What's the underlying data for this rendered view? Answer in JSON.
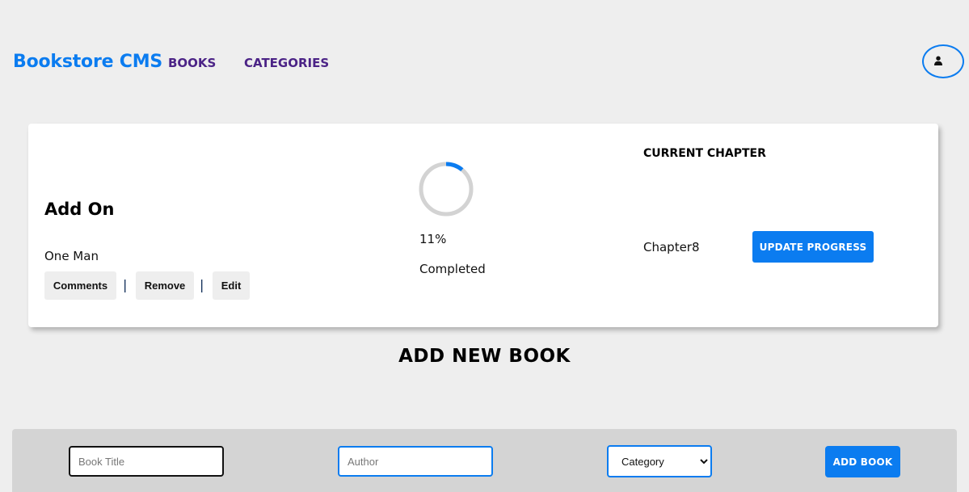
{
  "header": {
    "brand": "Bookstore CMS",
    "nav": {
      "books": "BOOKS",
      "categories": "CATEGORIES"
    },
    "user_icon": "user-icon"
  },
  "book": {
    "title": "Add On",
    "author": "One Man",
    "actions": {
      "comments": "Comments",
      "remove": "Remove",
      "edit": "Edit"
    },
    "separator": "|",
    "progress": {
      "percent_value": 11,
      "percent_label": "11%",
      "status": "Completed"
    },
    "chapter": {
      "heading": "CURRENT CHAPTER",
      "value": "Chapter8",
      "update_label": "UPDATE PROGRESS"
    }
  },
  "add_book": {
    "heading": "ADD NEW BOOK",
    "title_placeholder": "Book Title",
    "author_placeholder": "Author",
    "category_selected": "Category",
    "submit_label": "ADD BOOK"
  },
  "colors": {
    "accent": "#0b7cf0",
    "nav": "#4b2386",
    "background": "#eeeeee",
    "panel": "#d4d4d4",
    "progress_track": "#d3d3d3"
  }
}
